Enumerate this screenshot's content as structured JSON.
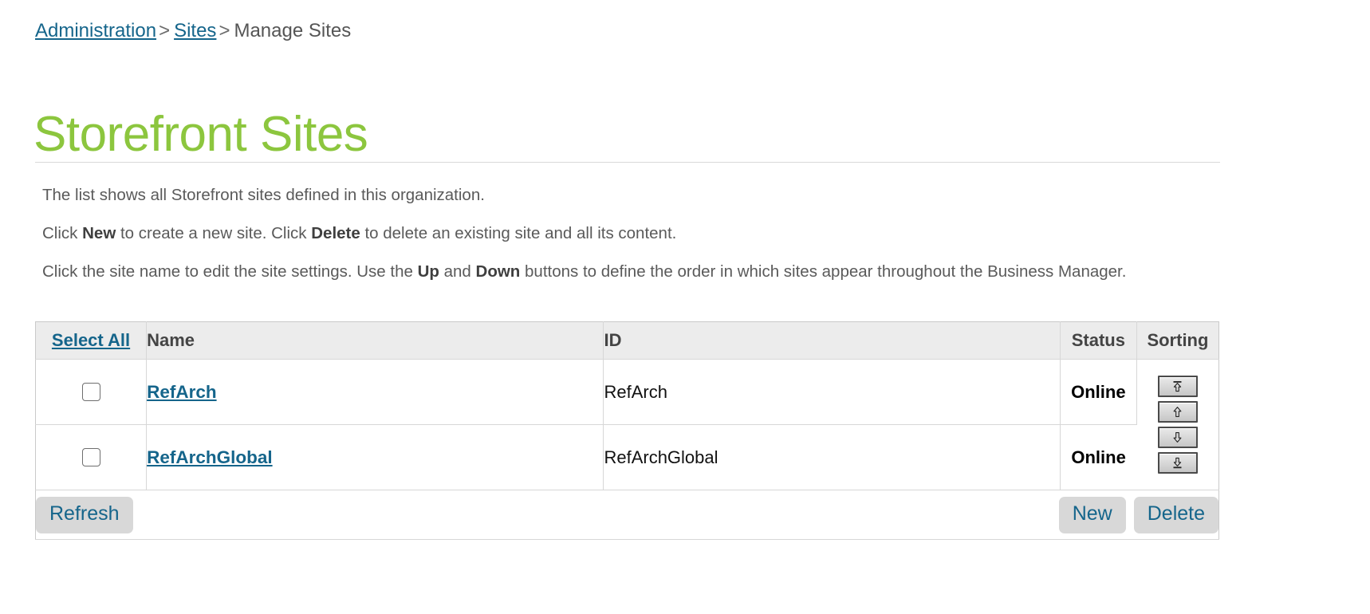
{
  "breadcrumb": {
    "items": [
      {
        "label": "Administration",
        "link": true
      },
      {
        "label": "Sites",
        "link": true
      },
      {
        "label": "Manage Sites",
        "link": false
      }
    ],
    "separator": ">"
  },
  "page_title": "Storefront Sites",
  "title_color": "#8CC63E",
  "link_color": "#15658B",
  "description": {
    "line1": "The list shows all Storefront sites defined in this organization.",
    "line2_a": "Click ",
    "line2_b1": "New",
    "line2_c": " to create a new site. Click ",
    "line2_b2": "Delete",
    "line2_d": " to delete an existing site and all its content.",
    "line3_a": "Click the site name to edit the site settings. Use the ",
    "line3_b1": "Up",
    "line3_c": " and ",
    "line3_b2": "Down",
    "line3_d": " buttons to define the order in which sites appear throughout the Business Manager."
  },
  "table": {
    "headers": {
      "select_all": "Select All",
      "name": "Name",
      "id": "ID",
      "status": "Status",
      "sorting": "Sorting"
    },
    "rows": [
      {
        "checked": false,
        "name": "RefArch",
        "id": "RefArch",
        "status": "Online"
      },
      {
        "checked": false,
        "name": "RefArchGlobal",
        "id": "RefArchGlobal",
        "status": "Online"
      }
    ],
    "sorting_buttons": [
      {
        "name": "move-to-top-icon",
        "title": "Move to top"
      },
      {
        "name": "move-up-icon",
        "title": "Move up"
      },
      {
        "name": "move-down-icon",
        "title": "Move down"
      },
      {
        "name": "move-to-bottom-icon",
        "title": "Move to bottom"
      }
    ]
  },
  "footer": {
    "refresh_label": "Refresh",
    "new_label": "New",
    "delete_label": "Delete"
  }
}
